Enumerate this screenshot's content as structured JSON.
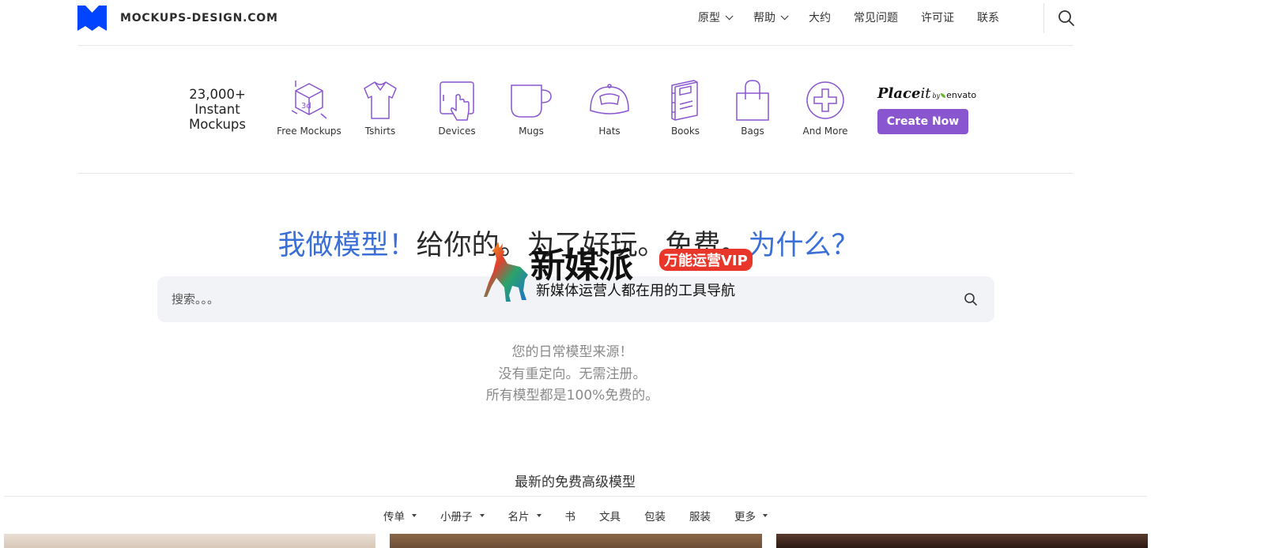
{
  "header": {
    "logo_text": "MOCKUPS-DESIGN.COM",
    "nav": [
      {
        "label": "原型",
        "dropdown": true
      },
      {
        "label": "帮助",
        "dropdown": true
      },
      {
        "label": "大约",
        "dropdown": false
      },
      {
        "label": "常见问题",
        "dropdown": false
      },
      {
        "label": "许可证",
        "dropdown": false
      },
      {
        "label": "联系",
        "dropdown": false
      }
    ]
  },
  "categories": {
    "count_line1": "23,000+",
    "count_line2": "Instant",
    "count_line3": "Mockups",
    "items": [
      {
        "label": "Free Mockups",
        "icon": "3d-box-icon"
      },
      {
        "label": "Tshirts",
        "icon": "tshirt-icon"
      },
      {
        "label": "Devices",
        "icon": "tablet-touch-icon"
      },
      {
        "label": "Mugs",
        "icon": "mug-icon"
      },
      {
        "label": "Hats",
        "icon": "cap-icon"
      },
      {
        "label": "Books",
        "icon": "book-icon"
      },
      {
        "label": "Bags",
        "icon": "bag-icon"
      },
      {
        "label": "And More",
        "icon": "plus-circle-icon"
      }
    ],
    "placeit_word": "Place",
    "placeit_it": "it",
    "placeit_by": "by",
    "placeit_envato": "envato",
    "create_label": "Create Now"
  },
  "hero": {
    "part1": "我做模型！",
    "part2": "给你的。为了好玩。免费。",
    "part3": "为什么？",
    "search_placeholder": "搜索。。。",
    "tagline1": "您的日常模型来源！",
    "tagline2": "没有重定向。无需注册。",
    "tagline3": "所有模型都是100%免费的。"
  },
  "watermark": {
    "main": "新媒派",
    "badge": "万能运营VIP",
    "sub": "新媒体运营人都在用的工具导航"
  },
  "latest": {
    "title": "最新的免费高级模型",
    "filters": [
      {
        "label": "传单",
        "dropdown": true
      },
      {
        "label": "小册子",
        "dropdown": true
      },
      {
        "label": "名片",
        "dropdown": true
      },
      {
        "label": "书",
        "dropdown": false
      },
      {
        "label": "文具",
        "dropdown": false
      },
      {
        "label": "包装",
        "dropdown": false
      },
      {
        "label": "服装",
        "dropdown": false
      },
      {
        "label": "更多",
        "dropdown": true
      }
    ]
  },
  "colors": {
    "brand_blue": "#0044ff",
    "accent_purple": "#8a56cf",
    "hero_blue": "#3a6fd8"
  }
}
